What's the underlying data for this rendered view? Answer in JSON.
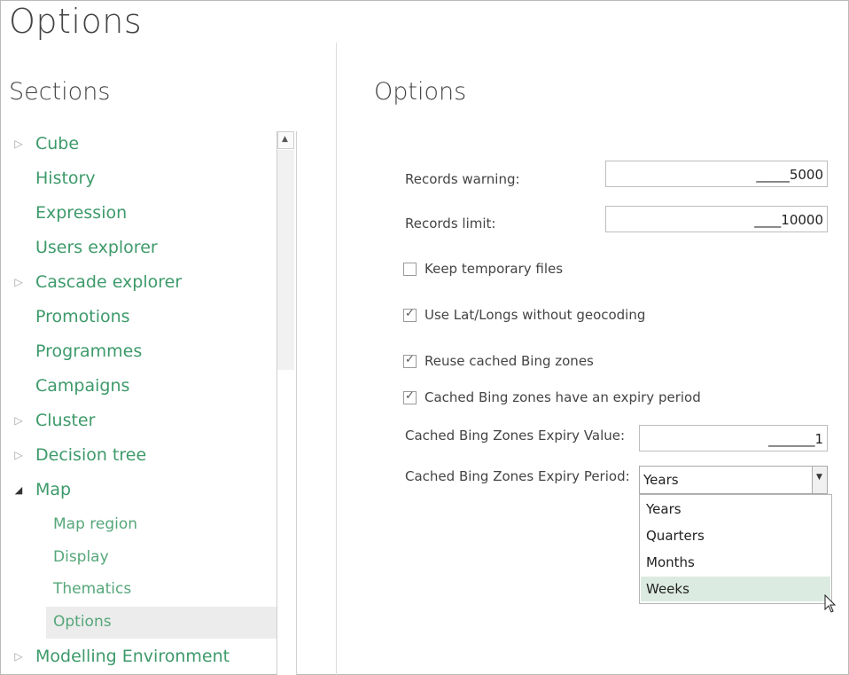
{
  "window": {
    "title": "Options"
  },
  "sections": {
    "title": "Sections",
    "items": [
      {
        "label": "Cube",
        "arrow": "▷",
        "level": 0
      },
      {
        "label": "History",
        "arrow": "",
        "level": 0
      },
      {
        "label": "Expression",
        "arrow": "",
        "level": 0
      },
      {
        "label": "Users explorer",
        "arrow": "",
        "level": 0
      },
      {
        "label": "Cascade explorer",
        "arrow": "▷",
        "level": 0
      },
      {
        "label": "Promotions",
        "arrow": "",
        "level": 0
      },
      {
        "label": "Programmes",
        "arrow": "",
        "level": 0
      },
      {
        "label": "Campaigns",
        "arrow": "",
        "level": 0
      },
      {
        "label": "Cluster",
        "arrow": "▷",
        "level": 0
      },
      {
        "label": "Decision tree",
        "arrow": "▷",
        "level": 0
      },
      {
        "label": "Map",
        "arrow": "◢",
        "level": 0
      },
      {
        "label": "Map region",
        "arrow": "",
        "level": 1
      },
      {
        "label": "Display",
        "arrow": "",
        "level": 1
      },
      {
        "label": "Thematics",
        "arrow": "",
        "level": 1
      },
      {
        "label": "Options",
        "arrow": "",
        "level": 1,
        "selected": true
      },
      {
        "label": "Modelling Environment",
        "arrow": "▷",
        "level": 0
      }
    ]
  },
  "options": {
    "title": "Options",
    "records_warning": {
      "label": "Records warning:",
      "value": "_____5000"
    },
    "records_limit": {
      "label": "Records limit:",
      "value": "____10000"
    },
    "keep_temp": {
      "label": "Keep temporary files",
      "checked": false
    },
    "use_latlong": {
      "label": "Use Lat/Longs without geocoding",
      "checked": true
    },
    "reuse_bing": {
      "label": "Reuse cached Bing zones",
      "checked": true
    },
    "bing_expiry": {
      "label": "Cached Bing zones have an expiry period",
      "checked": true
    },
    "expiry_value": {
      "label": "Cached Bing Zones Expiry Value:",
      "value": "_______1"
    },
    "expiry_period": {
      "label": "Cached Bing Zones Expiry Period:",
      "selected": "Years",
      "options": [
        "Years",
        "Quarters",
        "Months",
        "Weeks"
      ],
      "hovered": "Weeks"
    }
  },
  "colors": {
    "accent_green": "#3d9a6a",
    "hover_green": "#dcebe2",
    "selected_gray": "#ececec"
  }
}
